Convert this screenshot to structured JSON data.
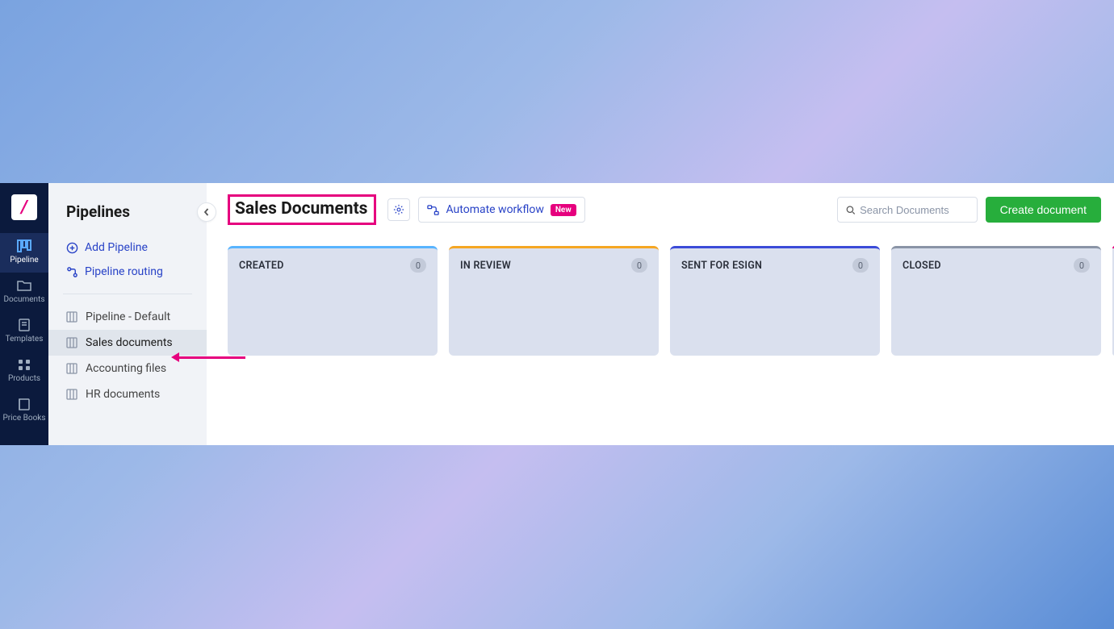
{
  "rail": {
    "items": [
      {
        "label": "Pipeline",
        "active": true
      },
      {
        "label": "Documents"
      },
      {
        "label": "Templates"
      },
      {
        "label": "Products"
      },
      {
        "label": "Price Books"
      }
    ]
  },
  "sidebar": {
    "title": "Pipelines",
    "actions": {
      "add": "Add Pipeline",
      "routing": "Pipeline routing"
    },
    "pipelines": [
      {
        "label": "Pipeline - Default"
      },
      {
        "label": "Sales documents",
        "active": true
      },
      {
        "label": "Accounting files"
      },
      {
        "label": "HR documents"
      }
    ]
  },
  "toolbar": {
    "title": "Sales Documents",
    "automate_label": "Automate workflow",
    "new_badge": "New",
    "search_placeholder": "Search Documents",
    "create_label": "Create document"
  },
  "columns": [
    {
      "title": "CREATED",
      "count": "0",
      "accent": "#58b4ff"
    },
    {
      "title": "IN REVIEW",
      "count": "0",
      "accent": "#f5a623"
    },
    {
      "title": "SENT FOR ESIGN",
      "count": "0",
      "accent": "#3b4bd8"
    },
    {
      "title": "CLOSED",
      "count": "0",
      "accent": "#8a94a6"
    }
  ]
}
